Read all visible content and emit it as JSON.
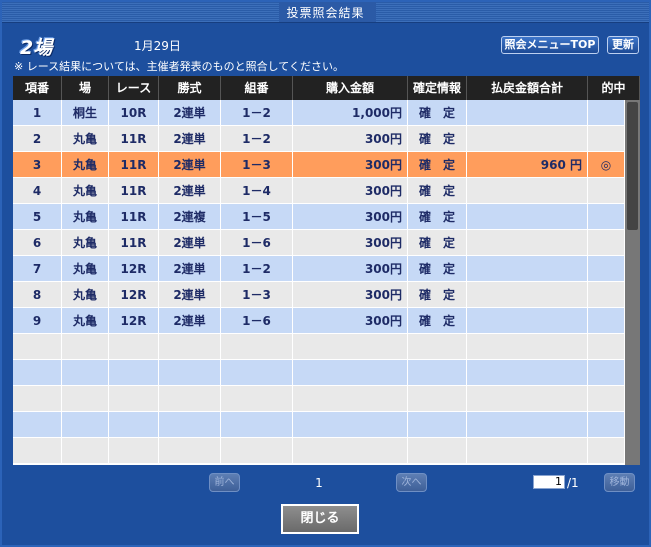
{
  "window": {
    "title": "投票照会結果"
  },
  "header": {
    "logo_text": "2場",
    "date": "1月29日",
    "notice": "※ レース結果については、主催者発表のものと照合してください。",
    "menu_top_label": "照会メニューTOP",
    "refresh_label": "更新"
  },
  "table": {
    "columns": [
      "項番",
      "場",
      "レース",
      "勝式",
      "組番",
      "購入金額",
      "確定情報",
      "払戻金額合計",
      "的中"
    ],
    "rows": [
      {
        "no": "1",
        "place": "桐生",
        "race": "10R",
        "type": "2連単",
        "combo": "1－2",
        "amount": "1,000円",
        "status": "確　定",
        "payout": "",
        "hit": ""
      },
      {
        "no": "2",
        "place": "丸亀",
        "race": "11R",
        "type": "2連単",
        "combo": "1－2",
        "amount": "300円",
        "status": "確　定",
        "payout": "",
        "hit": ""
      },
      {
        "no": "3",
        "place": "丸亀",
        "race": "11R",
        "type": "2連単",
        "combo": "1－3",
        "amount": "300円",
        "status": "確　定",
        "payout": "960 円",
        "hit": "◎",
        "highlight": true
      },
      {
        "no": "4",
        "place": "丸亀",
        "race": "11R",
        "type": "2連単",
        "combo": "1－4",
        "amount": "300円",
        "status": "確　定",
        "payout": "",
        "hit": ""
      },
      {
        "no": "5",
        "place": "丸亀",
        "race": "11R",
        "type": "2連複",
        "combo": "1－5",
        "amount": "300円",
        "status": "確　定",
        "payout": "",
        "hit": ""
      },
      {
        "no": "6",
        "place": "丸亀",
        "race": "11R",
        "type": "2連単",
        "combo": "1－6",
        "amount": "300円",
        "status": "確　定",
        "payout": "",
        "hit": ""
      },
      {
        "no": "7",
        "place": "丸亀",
        "race": "12R",
        "type": "2連単",
        "combo": "1－2",
        "amount": "300円",
        "status": "確　定",
        "payout": "",
        "hit": ""
      },
      {
        "no": "8",
        "place": "丸亀",
        "race": "12R",
        "type": "2連単",
        "combo": "1－3",
        "amount": "300円",
        "status": "確　定",
        "payout": "",
        "hit": ""
      },
      {
        "no": "9",
        "place": "丸亀",
        "race": "12R",
        "type": "2連単",
        "combo": "1－6",
        "amount": "300円",
        "status": "確　定",
        "payout": "",
        "hit": ""
      },
      {
        "no": "",
        "place": "",
        "race": "",
        "type": "",
        "combo": "",
        "amount": "",
        "status": "",
        "payout": "",
        "hit": ""
      },
      {
        "no": "",
        "place": "",
        "race": "",
        "type": "",
        "combo": "",
        "amount": "",
        "status": "",
        "payout": "",
        "hit": ""
      },
      {
        "no": "",
        "place": "",
        "race": "",
        "type": "",
        "combo": "",
        "amount": "",
        "status": "",
        "payout": "",
        "hit": ""
      },
      {
        "no": "",
        "place": "",
        "race": "",
        "type": "",
        "combo": "",
        "amount": "",
        "status": "",
        "payout": "",
        "hit": ""
      },
      {
        "no": "",
        "place": "",
        "race": "",
        "type": "",
        "combo": "",
        "amount": "",
        "status": "",
        "payout": "",
        "hit": ""
      }
    ]
  },
  "pager": {
    "prev_label": "前へ",
    "next_label": "次へ",
    "current_page": "1",
    "input_value": "1",
    "total": "/1",
    "go_label": "移動"
  },
  "footer": {
    "close_label": "閉じる"
  },
  "colors": {
    "background": "#1d4f9e",
    "header_row": "#222222",
    "row_odd": "#c6d9f6",
    "row_even": "#e9e9e9",
    "row_highlight": "#ff9d5c",
    "cell_text": "#1e2b66"
  }
}
